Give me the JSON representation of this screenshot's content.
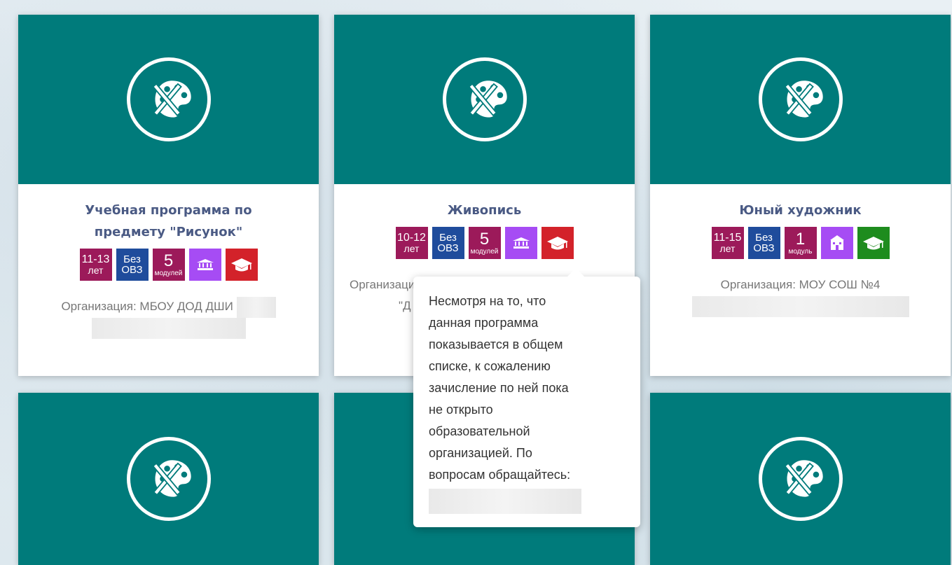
{
  "cards": [
    {
      "title_lines": [
        "Учебная программа по",
        "предмету \"Рисунок\""
      ],
      "age_range": "11-13",
      "age_unit": "лет",
      "ovz_line1": "Без",
      "ovz_line2": "ОВЗ",
      "modules_count": "5",
      "modules_label": "модулей",
      "org_text": "Организация: МБОУ ДОД ДШИ"
    },
    {
      "title_lines": [
        "Живопись"
      ],
      "age_range": "10-12",
      "age_unit": "лет",
      "ovz_line1": "Без",
      "ovz_line2": "ОВЗ",
      "modules_count": "5",
      "modules_label": "модулей",
      "org_text": "Организация",
      "org_line2": "\"Д"
    },
    {
      "title_lines": [
        "Юный художник"
      ],
      "age_range": "11-15",
      "age_unit": "лет",
      "ovz_line1": "Без",
      "ovz_line2": "ОВЗ",
      "modules_count": "1",
      "modules_label": "модуль",
      "org_text": "Организация: МОУ СОШ №4"
    }
  ],
  "tooltip": {
    "lines": [
      "Несмотря на то, что",
      "данная программа",
      "показывается в общем",
      "списке, к сожалению",
      "зачисление по ней пока",
      "не открыто",
      "образовательной",
      "организацией. По",
      "вопросам обращайтесь:"
    ]
  },
  "icons": {
    "card": "palette-brush-icon",
    "org_type": "institution-icon",
    "education": "graduation-cap-icon"
  },
  "colors": {
    "card_header": "#007b7b",
    "title": "#4a5a84",
    "age_badge": "#9c1a5a",
    "ovz_badge": "#1f4c9c",
    "org_badge": "#a64cf4",
    "closed_badge": "#d3222a",
    "open_badge": "#1e8c1e"
  }
}
